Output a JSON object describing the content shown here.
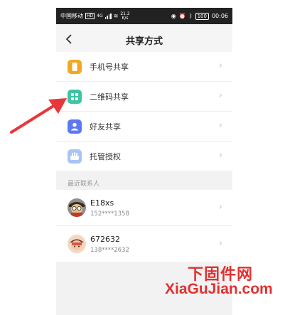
{
  "status_bar": {
    "carrier": "中国移动",
    "hd": "HD",
    "network": "4G",
    "speed_value": "21.2",
    "speed_unit": "K/s",
    "battery": "100",
    "time": "00:06"
  },
  "nav": {
    "title": "共享方式"
  },
  "menu": {
    "items": [
      {
        "label": "手机号共享",
        "color": "#f5a623"
      },
      {
        "label": "二维码共享",
        "color": "#3ec4a4"
      },
      {
        "label": "好友共享",
        "color": "#5b78f5"
      },
      {
        "label": "托管授权",
        "color": "#a9c3f7"
      }
    ]
  },
  "section": {
    "recent_contacts": "最近联系人"
  },
  "contacts": [
    {
      "name": "E18xs",
      "phone": "152****1358"
    },
    {
      "name": "672632",
      "phone": "138****2632"
    }
  ],
  "watermark": {
    "cn": "下固件网",
    "en": "XiaGuJian.com"
  },
  "colors": {
    "annotation_arrow": "#e8373a"
  }
}
